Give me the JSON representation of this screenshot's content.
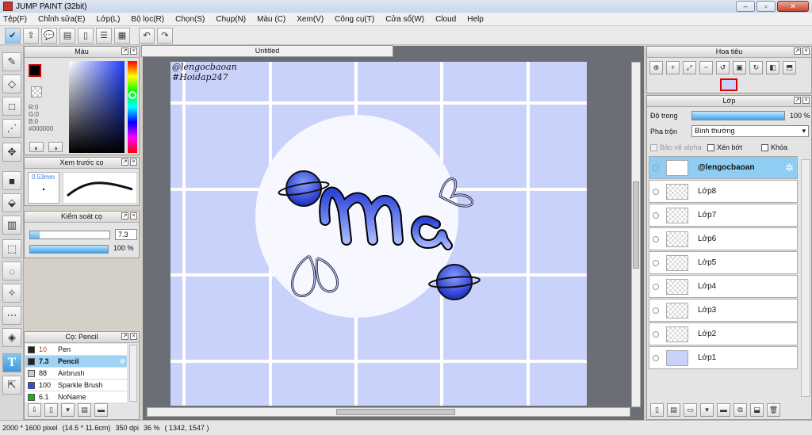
{
  "window": {
    "title": "JUMP PAINT (32bit)"
  },
  "menu": [
    "Tệp(F)",
    "Chỉnh sửa(E)",
    "Lớp(L)",
    "Bộ lọc(R)",
    "Chọn(S)",
    "Chụp(N)",
    "Màu (C)",
    "Xem(V)",
    "Công cụ(T)",
    "Cửa sổ(W)",
    "Cloud",
    "Help"
  ],
  "document": {
    "tab_title": "Untitled"
  },
  "color_panel": {
    "title": "Màu",
    "r": "R:0",
    "g": "G:0",
    "b": "B:0",
    "hex": "#000000"
  },
  "brush_preview": {
    "title": "Xem trước cọ",
    "size": "0.53mm"
  },
  "brush_control": {
    "title": "Kiểm soát cọ",
    "size_value": "7.3",
    "opacity_value": "100 %"
  },
  "brush_list": {
    "title": "Cọ: Pencil",
    "items": [
      {
        "size": "10",
        "name": "Pen",
        "color": "#222222"
      },
      {
        "size": "7.3",
        "name": "Pencil",
        "color": "#222222"
      },
      {
        "size": "88",
        "name": "Airbrush",
        "color": "#cccccc"
      },
      {
        "size": "100",
        "name": "Sparkle Brush",
        "color": "#2e4fd6"
      },
      {
        "size": "6.1",
        "name": "NoName",
        "color": "#22aa22"
      }
    ]
  },
  "navigator": {
    "title": "Hoa tiêu"
  },
  "layer_panel": {
    "title": "Lớp",
    "opacity_label": "Độ trong",
    "opacity_value": "100 %",
    "blend_label": "Pha trộn",
    "blend_value": "Bình thường",
    "protect_alpha": "Bảo vệ alpha",
    "clipping": "Xén bớt",
    "lock": "Khóa",
    "layers": [
      {
        "name": "@lengocbaoan",
        "selected": true
      },
      {
        "name": "Lớp8",
        "selected": false
      },
      {
        "name": "Lớp7",
        "selected": false
      },
      {
        "name": "Lớp6",
        "selected": false
      },
      {
        "name": "Lớp5",
        "selected": false
      },
      {
        "name": "Lớp4",
        "selected": false
      },
      {
        "name": "Lớp3",
        "selected": false
      },
      {
        "name": "Lớp2",
        "selected": false
      },
      {
        "name": "Lớp1",
        "selected": false
      }
    ]
  },
  "art": {
    "watermark_1": "@lengocbaoan",
    "watermark_2": "#Hoidap247",
    "lettering": "Ma"
  },
  "status": {
    "size": "2000 * 1600 pixel",
    "cm": "(14.5 * 11.6cm)",
    "dpi": "350 dpi",
    "zoom": "36 %",
    "coords": "( 1342, 1547 )"
  },
  "colors": {
    "selected_layer": "#8fcdf2",
    "canvas_bg": "#c9d2fb",
    "canvas_grid": "#ffffff"
  }
}
